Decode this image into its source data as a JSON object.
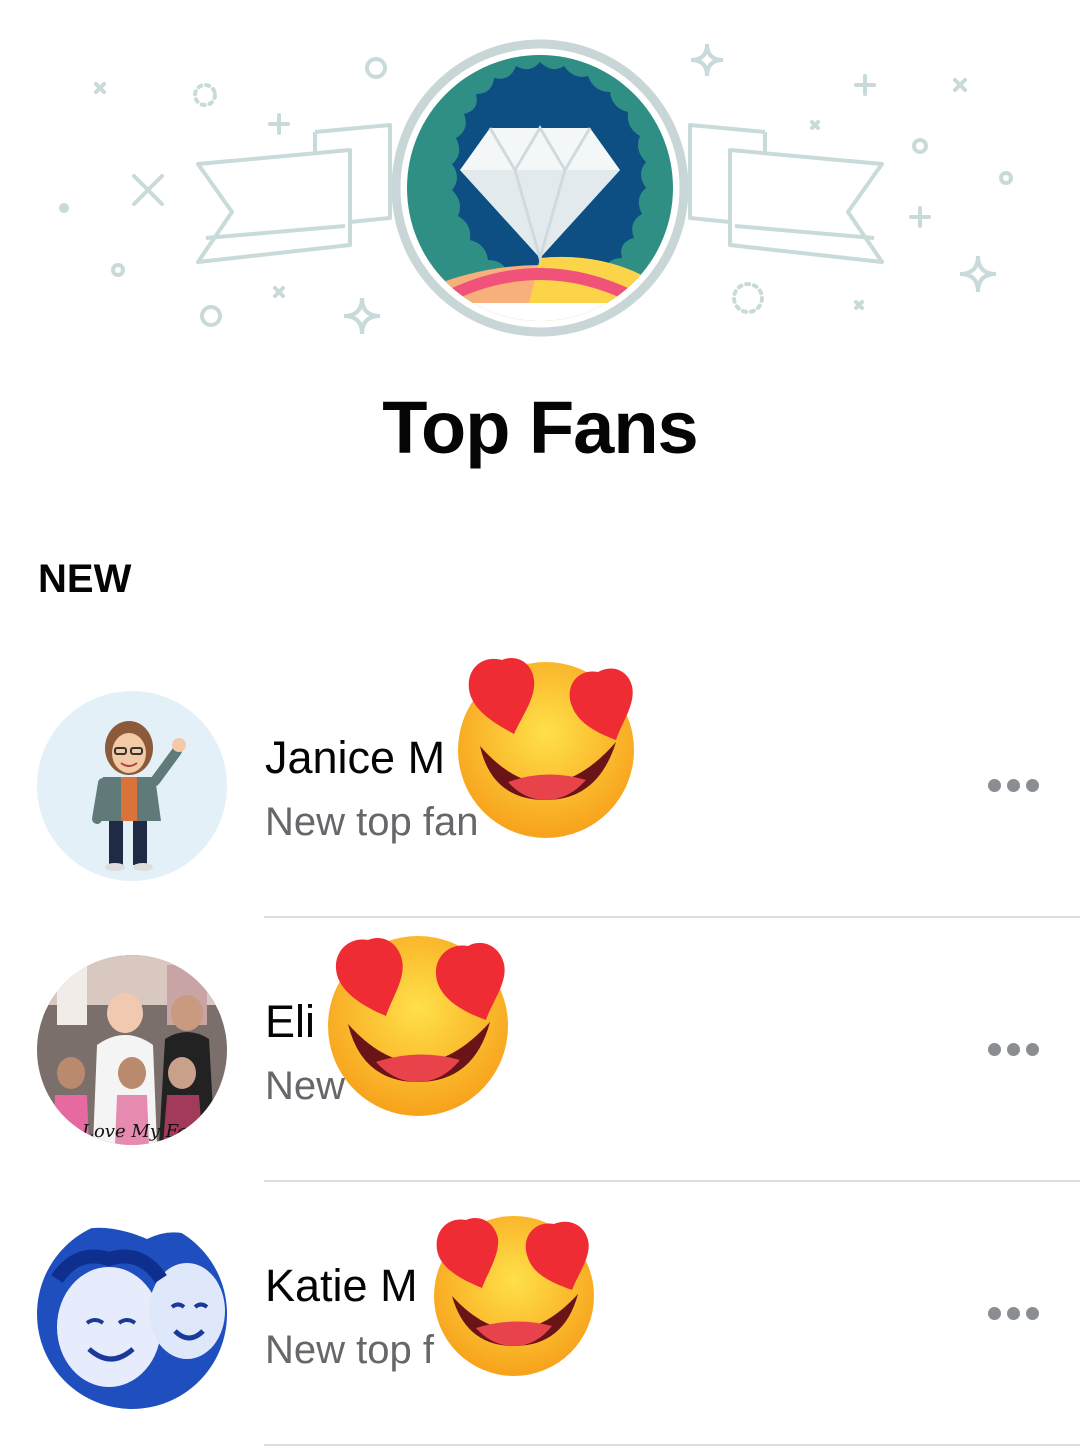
{
  "header": {
    "title": "Top Fans",
    "badge_icon": "diamond-badge-icon"
  },
  "section": {
    "label": "NEW"
  },
  "fans": [
    {
      "name": "Janice M",
      "subtitle": "New top fan",
      "more_icon": "more-options-icon"
    },
    {
      "name": "Eli",
      "subtitle": "New",
      "more_icon": "more-options-icon"
    },
    {
      "name": "Katie M",
      "subtitle": "New top f",
      "more_icon": "more-options-icon"
    }
  ],
  "stickers": [
    {
      "icon": "heart-eyes-emoji-icon"
    },
    {
      "icon": "heart-eyes-emoji-icon"
    },
    {
      "icon": "heart-eyes-emoji-icon"
    }
  ],
  "colors": {
    "badge_blue": "#0d4f82",
    "badge_ring": "#c9d6d8",
    "badge_pink": "#f0527a",
    "decor": "#c8dad9",
    "text_primary": "#050505",
    "text_secondary": "#65676b",
    "divider": "#dadde1",
    "more_dots": "#8a8d91"
  }
}
